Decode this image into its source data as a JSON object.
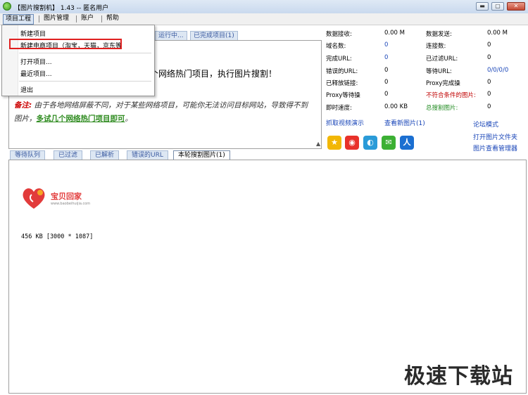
{
  "window": {
    "title": "【图片搜割机】 1.43 -- 匿名用户",
    "min_glyph": "▬",
    "max_glyph": "▢",
    "close_glyph": "✕"
  },
  "menu": {
    "items": [
      "项目工程",
      "图片管理",
      "账户",
      "帮助"
    ]
  },
  "dropdown": {
    "items": [
      "新建项目",
      "新建电商项目（淘宝，天猫，京东等",
      "打开项目...",
      "最近项目...",
      "退出"
    ],
    "highlighted_index": 1
  },
  "top_tabs": [
    "运行中...",
    "已完成项目(1)"
  ],
  "main": {
    "message": "个网络热门项目，执行图片搜割！",
    "note_label": "备注:",
    "note_text": "由于各地网络屏蔽不同，对于某些网络项目，可能你无法访问目标网站，导致得不到图片，",
    "note_link": "多试几个网络热门项目即可",
    "note_end": "。"
  },
  "stats": {
    "left": [
      {
        "label": "数据接收:",
        "value": "0.00 M",
        "color": "black"
      },
      {
        "label": "域名数:",
        "value": "0",
        "color": "blue"
      },
      {
        "label": "完成URL:",
        "value": "0",
        "color": "blue"
      },
      {
        "label": "错误的URL:",
        "value": "0",
        "color": "black"
      },
      {
        "label": "已释放链接:",
        "value": "0",
        "color": "black"
      },
      {
        "label": "Proxy等待操",
        "value": "0",
        "color": "black"
      },
      {
        "label": "即时速度:",
        "value": "0.00 KB",
        "color": "black"
      }
    ],
    "right": [
      {
        "label": "数据发送:",
        "value": "0.00 M",
        "label_color": "black"
      },
      {
        "label": "连接数:",
        "value": "0",
        "label_color": "black"
      },
      {
        "label": "已过滤URL:",
        "value": "0",
        "label_color": "black"
      },
      {
        "label": "等待URL:",
        "value": "0/0/0/0",
        "label_color": "black"
      },
      {
        "label": "Proxy完成操",
        "value": "0",
        "label_color": "black"
      },
      {
        "label": "不符合条件的图片:",
        "value": "0",
        "label_color": "red"
      },
      {
        "label": "总搜割图片:",
        "value": "0",
        "label_color": "green"
      }
    ]
  },
  "links": {
    "video": "抓取视频演示",
    "view_new": "查看新图片(1)",
    "forum": "论坛模式",
    "open_folder": "打开图片文件夹",
    "image_manager": "图片查看管理器"
  },
  "social_icons": [
    "qzone-icon",
    "weibo-icon",
    "tencent-weibo-icon",
    "wechat-icon",
    "people-icon"
  ],
  "bottom_tabs": [
    "等待队列",
    "已过滤",
    "已解析",
    "错误的URL",
    "本轮搜割图片(1)"
  ],
  "preview": {
    "logo_text": "宝贝回家",
    "logo_url": "www.baobeihuijia.com",
    "info": "456 KB [3000 * 1087]"
  },
  "watermark": "极速下载站",
  "colors": {
    "accent_red": "#e02020",
    "link_blue": "#1a46b8",
    "green": "#1f8a1f"
  }
}
